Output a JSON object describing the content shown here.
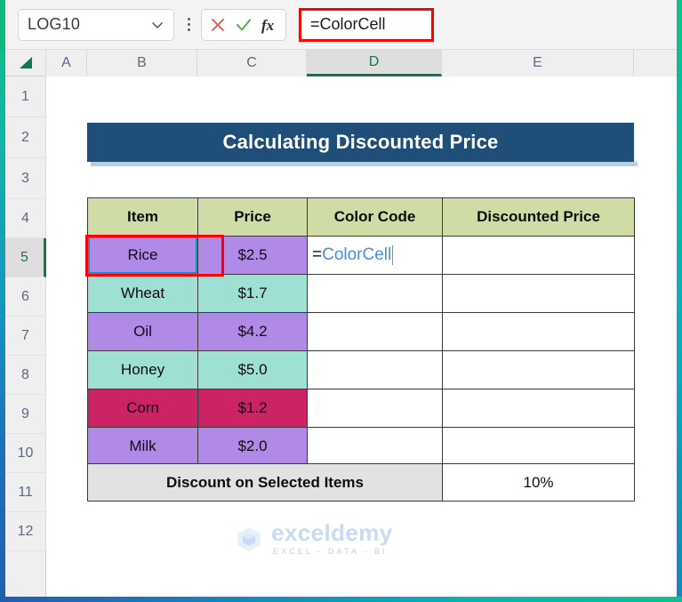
{
  "formula_bar": {
    "name_box_value": "LOG10",
    "name_box_chevron_icon": "chevron-down-icon",
    "kebab_icon": "more-options-icon",
    "cancel_icon": "cancel-x-icon",
    "confirm_icon": "confirm-check-icon",
    "function_icon": "fx-insert-function-icon",
    "formula_value": "=ColorCell"
  },
  "grid": {
    "select_all_icon": "select-all-triangle-icon",
    "columns": [
      "A",
      "B",
      "C",
      "D",
      "E"
    ],
    "selected_column": "D",
    "rows": [
      "1",
      "2",
      "3",
      "4",
      "5",
      "6",
      "7",
      "8",
      "9",
      "10",
      "11",
      "12"
    ],
    "selected_row": "5"
  },
  "sheet": {
    "title": "Calculating Discounted Price",
    "table": {
      "headers": [
        "Item",
        "Price",
        "Color Code",
        "Discounted Price"
      ],
      "rows": [
        {
          "item": "Rice",
          "price": "$2.5",
          "color_code": "=ColorCell",
          "discounted_price": "",
          "fill": "purple"
        },
        {
          "item": "Wheat",
          "price": "$1.7",
          "color_code": "",
          "discounted_price": "",
          "fill": "mint"
        },
        {
          "item": "Oil",
          "price": "$4.2",
          "color_code": "",
          "discounted_price": "",
          "fill": "purple"
        },
        {
          "item": "Honey",
          "price": "$5.0",
          "color_code": "",
          "discounted_price": "",
          "fill": "mint"
        },
        {
          "item": "Corn",
          "price": "$1.2",
          "color_code": "",
          "discounted_price": "",
          "fill": "crimson"
        },
        {
          "item": "Milk",
          "price": "$2.0",
          "color_code": "",
          "discounted_price": "",
          "fill": "purple"
        }
      ]
    },
    "discount": {
      "label": "Discount on Selected Items",
      "value": "10%"
    },
    "editing_cell": {
      "equals": "=",
      "name": "ColorCell"
    }
  },
  "watermark": {
    "logo_icon": "exceldemy-cube-logo-icon",
    "brand": "exceldemy",
    "tagline": "EXCEL - DATA - BI"
  },
  "colors": {
    "title_bg": "#1f4e79",
    "header_bg": "#cfdca6",
    "fill_purple": "#b18ae8",
    "fill_mint": "#9fe0d5",
    "fill_crimson": "#cc2366",
    "annotation_red": "#ff0000",
    "formula_blue": "#4a90d9",
    "excel_green": "#107c41"
  }
}
